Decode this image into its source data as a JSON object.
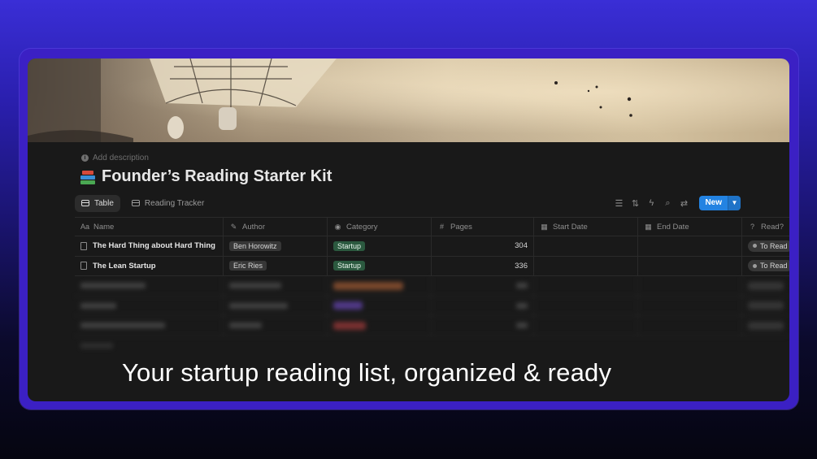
{
  "colors": {
    "accent": "#2383e2",
    "tag_category": "#2b593f",
    "tag_neutral": "#373737",
    "background": "#191919"
  },
  "page": {
    "add_description": "Add description",
    "title_icon": "books-emoji",
    "title": "Founder’s Reading Starter Kit"
  },
  "views": [
    {
      "label": "Table",
      "icon": "table-icon",
      "active": true
    },
    {
      "label": "Reading Tracker",
      "icon": "board-icon",
      "active": false
    }
  ],
  "toolbar": {
    "icons": [
      "filter-icon",
      "sort-icon",
      "automation-icon",
      "search-icon",
      "settings-icon"
    ],
    "new_label": "New"
  },
  "table": {
    "columns": [
      {
        "label": "Name",
        "icon": "Aa"
      },
      {
        "label": "Author",
        "icon": "pen-icon"
      },
      {
        "label": "Category",
        "icon": "select-icon"
      },
      {
        "label": "Pages",
        "icon": "number-icon"
      },
      {
        "label": "Start Date",
        "icon": "calendar-icon"
      },
      {
        "label": "End Date",
        "icon": "calendar-icon"
      },
      {
        "label": "Read?",
        "icon": "question-icon"
      }
    ],
    "rows": [
      {
        "name": "The Hard Thing about Hard Thing",
        "author": "Ben Horowitz",
        "category": "Startup",
        "pages": "304",
        "start": "",
        "end": "",
        "read": "To Read"
      },
      {
        "name": "The Lean Startup",
        "author": "Eric Ries",
        "category": "Startup",
        "pages": "336",
        "start": "",
        "end": "",
        "read": "To Read"
      }
    ]
  },
  "caption": "Your startup reading list, organized & ready"
}
